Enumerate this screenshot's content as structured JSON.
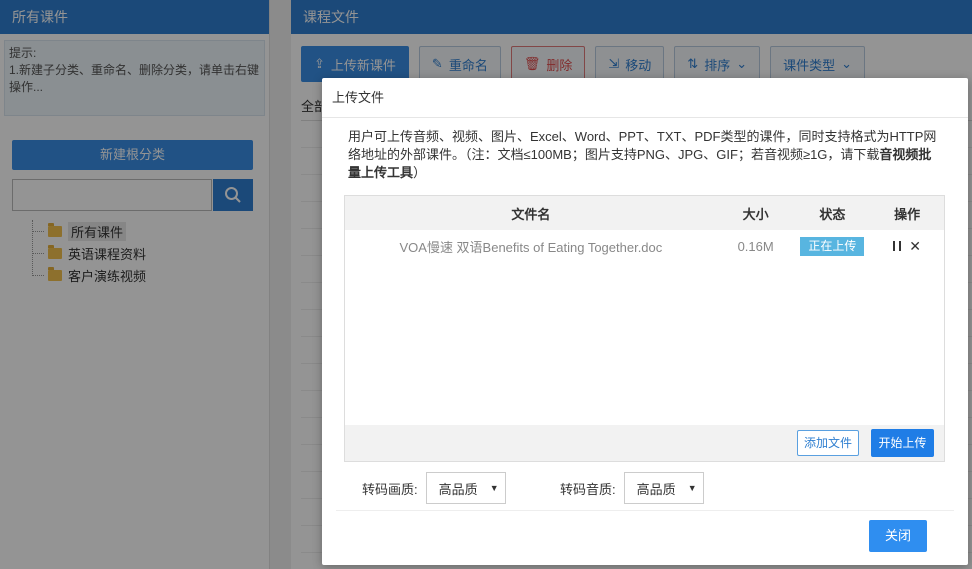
{
  "left_panel": {
    "title": "所有课件",
    "tip_label": "提示:",
    "tip_text": "1.新建子分类、重命名、删除分类，请单击右键操作...",
    "new_root_label": "新建根分类",
    "tree": [
      {
        "label": "所有课件",
        "selected": true
      },
      {
        "label": "英语课程资料",
        "selected": false
      },
      {
        "label": "客户演练视频",
        "selected": false
      }
    ]
  },
  "right_panel": {
    "title": "课程文件",
    "toolbar": {
      "upload": "上传新课件",
      "rename": "重命名",
      "delete": "删除",
      "move": "移动",
      "sort": "排序",
      "type": "课件类型"
    },
    "sub_label": "全部"
  },
  "modal": {
    "title": "上传文件",
    "desc_part1": "用户可上传音频、视频、图片、Excel、Word、PPT、TXT、PDF类型的课件，同时支持格式为HTTP网络地址的外部课件。（注：文档≤100MB；图片支持PNG、JPG、GIF；若音视频≥1G，请下载",
    "desc_bold": "音视频批量上传工具",
    "desc_part2": "）",
    "table": {
      "headers": {
        "name": "文件名",
        "size": "大小",
        "status": "状态",
        "op": "操作"
      },
      "rows": [
        {
          "name": "VOA慢速 双语Benefits of Eating Together.doc",
          "size": "0.16M",
          "status": "正在上传"
        }
      ]
    },
    "add_file": "添加文件",
    "start_upload": "开始上传",
    "video_quality_label": "转码画质:",
    "video_quality_value": "高品质",
    "audio_quality_label": "转码音质:",
    "audio_quality_value": "高品质",
    "close": "关闭"
  },
  "colors": {
    "header_blue": "#2f7fd0",
    "primary": "#3a8ee6",
    "status_tag": "#58b5e0"
  }
}
